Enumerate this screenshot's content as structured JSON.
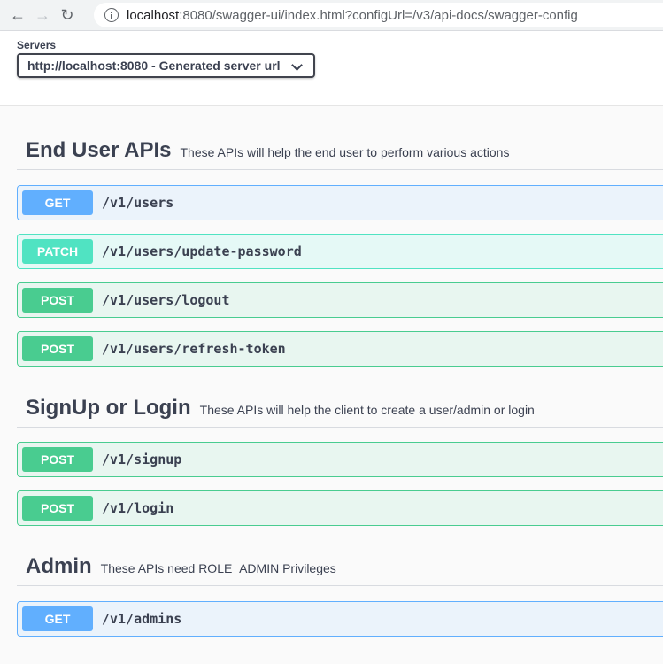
{
  "browser": {
    "url_host": "localhost",
    "url_rest": ":8080/swagger-ui/index.html?configUrl=/v3/api-docs/swagger-config"
  },
  "servers": {
    "label": "Servers",
    "selected": "http://localhost:8080 - Generated server url"
  },
  "tags": [
    {
      "name": "End User APIs",
      "description": "These APIs will help the end user to perform various actions",
      "operations": [
        {
          "method": "GET",
          "path": "/v1/users"
        },
        {
          "method": "PATCH",
          "path": "/v1/users/update-password"
        },
        {
          "method": "POST",
          "path": "/v1/users/logout"
        },
        {
          "method": "POST",
          "path": "/v1/users/refresh-token"
        }
      ]
    },
    {
      "name": "SignUp or Login",
      "description": "These APIs will help the client to create a user/admin or login",
      "operations": [
        {
          "method": "POST",
          "path": "/v1/signup"
        },
        {
          "method": "POST",
          "path": "/v1/login"
        }
      ]
    },
    {
      "name": "Admin",
      "description": "These APIs need ROLE_ADMIN Privileges",
      "operations": [
        {
          "method": "GET",
          "path": "/v1/admins"
        }
      ]
    }
  ],
  "colors": {
    "get": "#61affe",
    "patch": "#50e3c2",
    "post": "#49cc90"
  }
}
